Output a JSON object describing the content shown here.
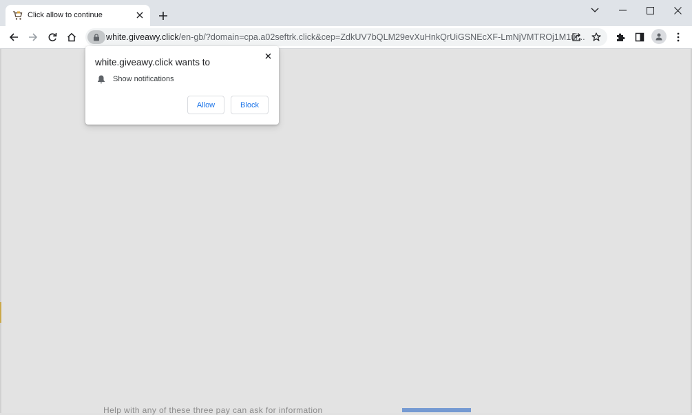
{
  "tab": {
    "title": "Click allow to continue",
    "favicon": "shopping-cart-icon"
  },
  "address_bar": {
    "host": "white.giveawy.click",
    "path": "/en-gb/?domain=cpa.a02seftrk.click&cep=ZdkUV7bQLM29evXuHnkQrUiGSNEcXF-LmNjVMTROj1M1ui..."
  },
  "permission_prompt": {
    "title": "white.giveawy.click wants to",
    "permission_label": "Show notifications",
    "allow_label": "Allow",
    "block_label": "Block"
  },
  "page": {
    "bottom_text": "Help with any of these three pay can ask for information"
  },
  "colors": {
    "accent": "#1a73e8",
    "tabstrip": "#dfe3e8",
    "content_bg": "#e3e3e3"
  }
}
